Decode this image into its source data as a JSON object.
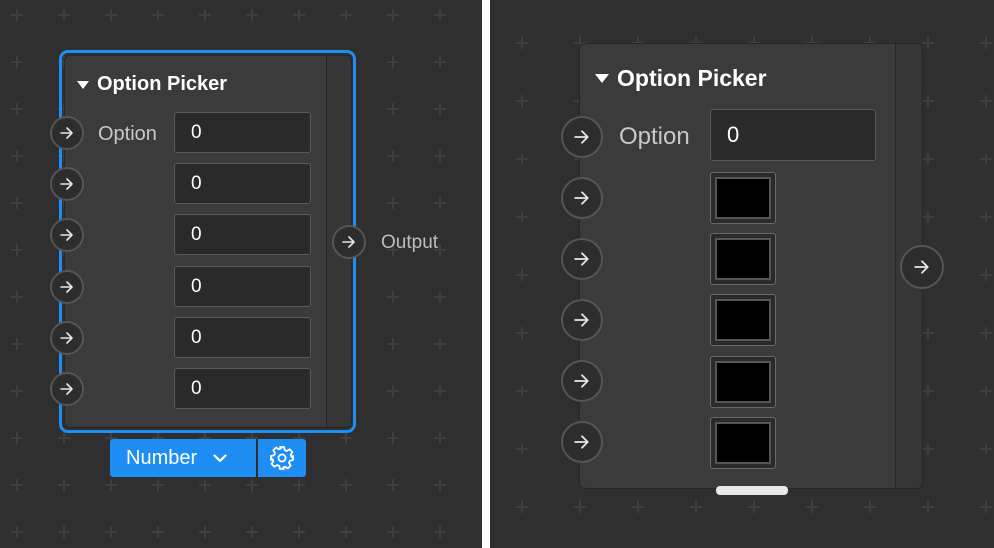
{
  "left_panel": {
    "node": {
      "title": "Option Picker",
      "option_label": "Option",
      "fields": [
        "0",
        "0",
        "0",
        "0",
        "0",
        "0"
      ],
      "output_label": "Output"
    },
    "type_selector": {
      "value": "Number"
    }
  },
  "right_panel": {
    "node": {
      "title": "Option Picker",
      "option_label": "Option",
      "option_value": "0",
      "color_swatches": [
        "#000000",
        "#000000",
        "#000000",
        "#000000",
        "#000000"
      ]
    }
  },
  "colors": {
    "canvas": "#2f2f2f",
    "node": "#3b3b3b",
    "selection_accent": "#1e8ef5",
    "swatch_fill": "#000000"
  },
  "icons": [
    "disclosure-triangle-icon",
    "arrow-right-icon",
    "chevron-down-icon",
    "gear-icon"
  ]
}
